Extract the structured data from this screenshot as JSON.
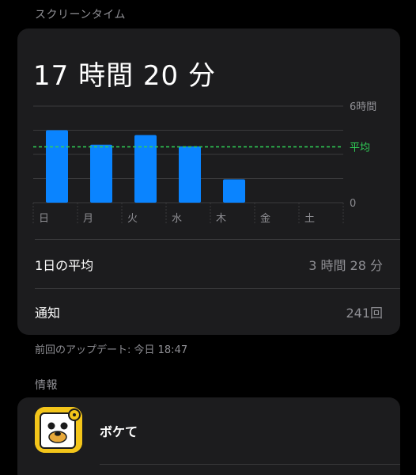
{
  "sections": {
    "screen_time_header": "スクリーンタイム",
    "info_header": "情報"
  },
  "summary": {
    "total": "17 時間 20 分",
    "daily_average_label": "1日の平均",
    "daily_average_value": "3 時間 28 分",
    "notifications_label": "通知",
    "notifications_value": "241回",
    "last_updated": "前回のアップデート: 今日 18:47"
  },
  "chart_data": {
    "type": "bar",
    "categories": [
      "日",
      "月",
      "火",
      "水",
      "木",
      "金",
      "土"
    ],
    "values": [
      4.5,
      3.6,
      4.2,
      3.5,
      1.45,
      0,
      0
    ],
    "ylim": [
      0,
      6
    ],
    "y_ticks": [
      {
        "value": 6,
        "label": "6時間"
      },
      {
        "value": 0,
        "label": "0"
      }
    ],
    "average": {
      "value": 3.47,
      "label": "平均"
    },
    "grid": true,
    "colors": {
      "bar": "#0a84ff",
      "average": "#30d158",
      "grid": "#3a3a3c",
      "label": "#8e8e93"
    }
  },
  "app": {
    "name": "ボケて",
    "icon": "boketeko-dog-icon"
  }
}
